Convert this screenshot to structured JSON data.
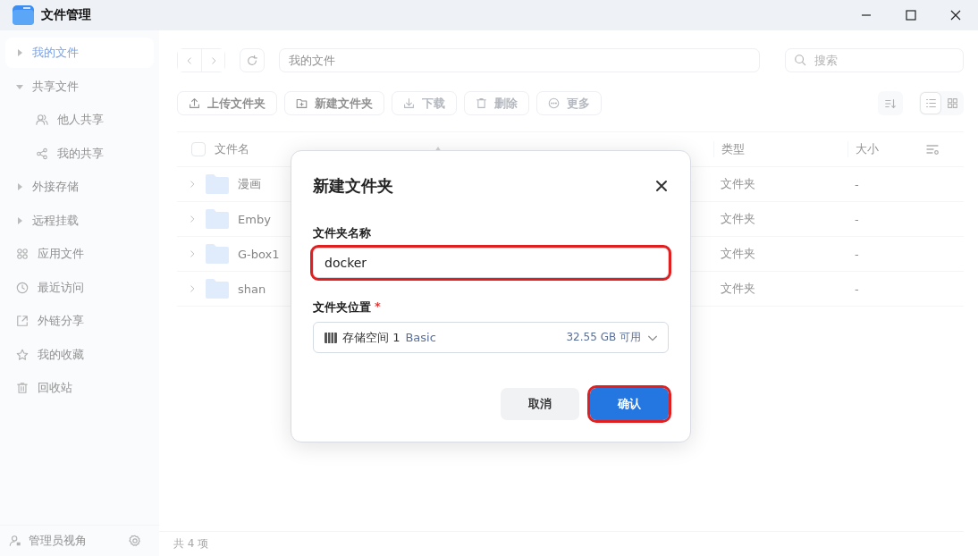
{
  "window": {
    "title": "文件管理"
  },
  "sidebar": {
    "items": [
      {
        "kind": "tree",
        "label": "我的文件",
        "selected": true,
        "expanded": false
      },
      {
        "kind": "tree",
        "label": "共享文件",
        "selected": false,
        "expanded": true,
        "children": [
          {
            "label": "他人共享",
            "selected": false
          },
          {
            "label": "我的共享",
            "selected": false
          }
        ]
      },
      {
        "kind": "tree",
        "label": "外接存储",
        "selected": false,
        "expanded": false
      },
      {
        "kind": "tree",
        "label": "远程挂载",
        "selected": false,
        "expanded": false
      },
      {
        "kind": "link",
        "label": "应用文件",
        "selected": false
      },
      {
        "kind": "link",
        "label": "最近访问",
        "selected": false
      },
      {
        "kind": "link",
        "label": "外链分享",
        "selected": false
      },
      {
        "kind": "link",
        "label": "我的收藏",
        "selected": false
      },
      {
        "kind": "link",
        "label": "回收站",
        "selected": false
      }
    ],
    "footer": {
      "label": "管理员视角"
    }
  },
  "path_field": {
    "value": "我的文件"
  },
  "search": {
    "placeholder": "搜索"
  },
  "toolbar": [
    {
      "label": "上传文件夹",
      "disabled": false
    },
    {
      "label": "新建文件夹",
      "disabled": false
    },
    {
      "label": "下载",
      "disabled": true
    },
    {
      "label": "删除",
      "disabled": true
    },
    {
      "label": "更多",
      "disabled": true
    }
  ],
  "view_toggle": [
    {
      "kind": "list",
      "selected": true
    },
    {
      "kind": "grid",
      "selected": false
    }
  ],
  "table": {
    "select_all": {
      "checked": false
    },
    "columns": [
      "文件名",
      "类型",
      "大小"
    ],
    "rows": [
      {
        "name": "漫画",
        "type": "文件夹",
        "size": "-"
      },
      {
        "name": "Emby",
        "type": "文件夹",
        "size": "-"
      },
      {
        "name": "G-box1",
        "type": "文件夹",
        "size": "-"
      },
      {
        "name": "shan",
        "type": "文件夹",
        "size": "-"
      }
    ]
  },
  "status_bar": {
    "count": "共 4 项"
  },
  "dialog": {
    "title": "新建文件夹",
    "name_field": {
      "label": "文件夹名称",
      "value": "docker",
      "highlighted": true
    },
    "location_field": {
      "label": "文件夹位置",
      "required_mark": "*",
      "value": "存储空间 1",
      "tag": "Basic",
      "free": "32.55 GB 可用"
    },
    "buttons": [
      {
        "kind": "secondary",
        "label": "取消",
        "highlighted": false
      },
      {
        "kind": "primary",
        "label": "确认",
        "highlighted": true
      }
    ]
  }
}
